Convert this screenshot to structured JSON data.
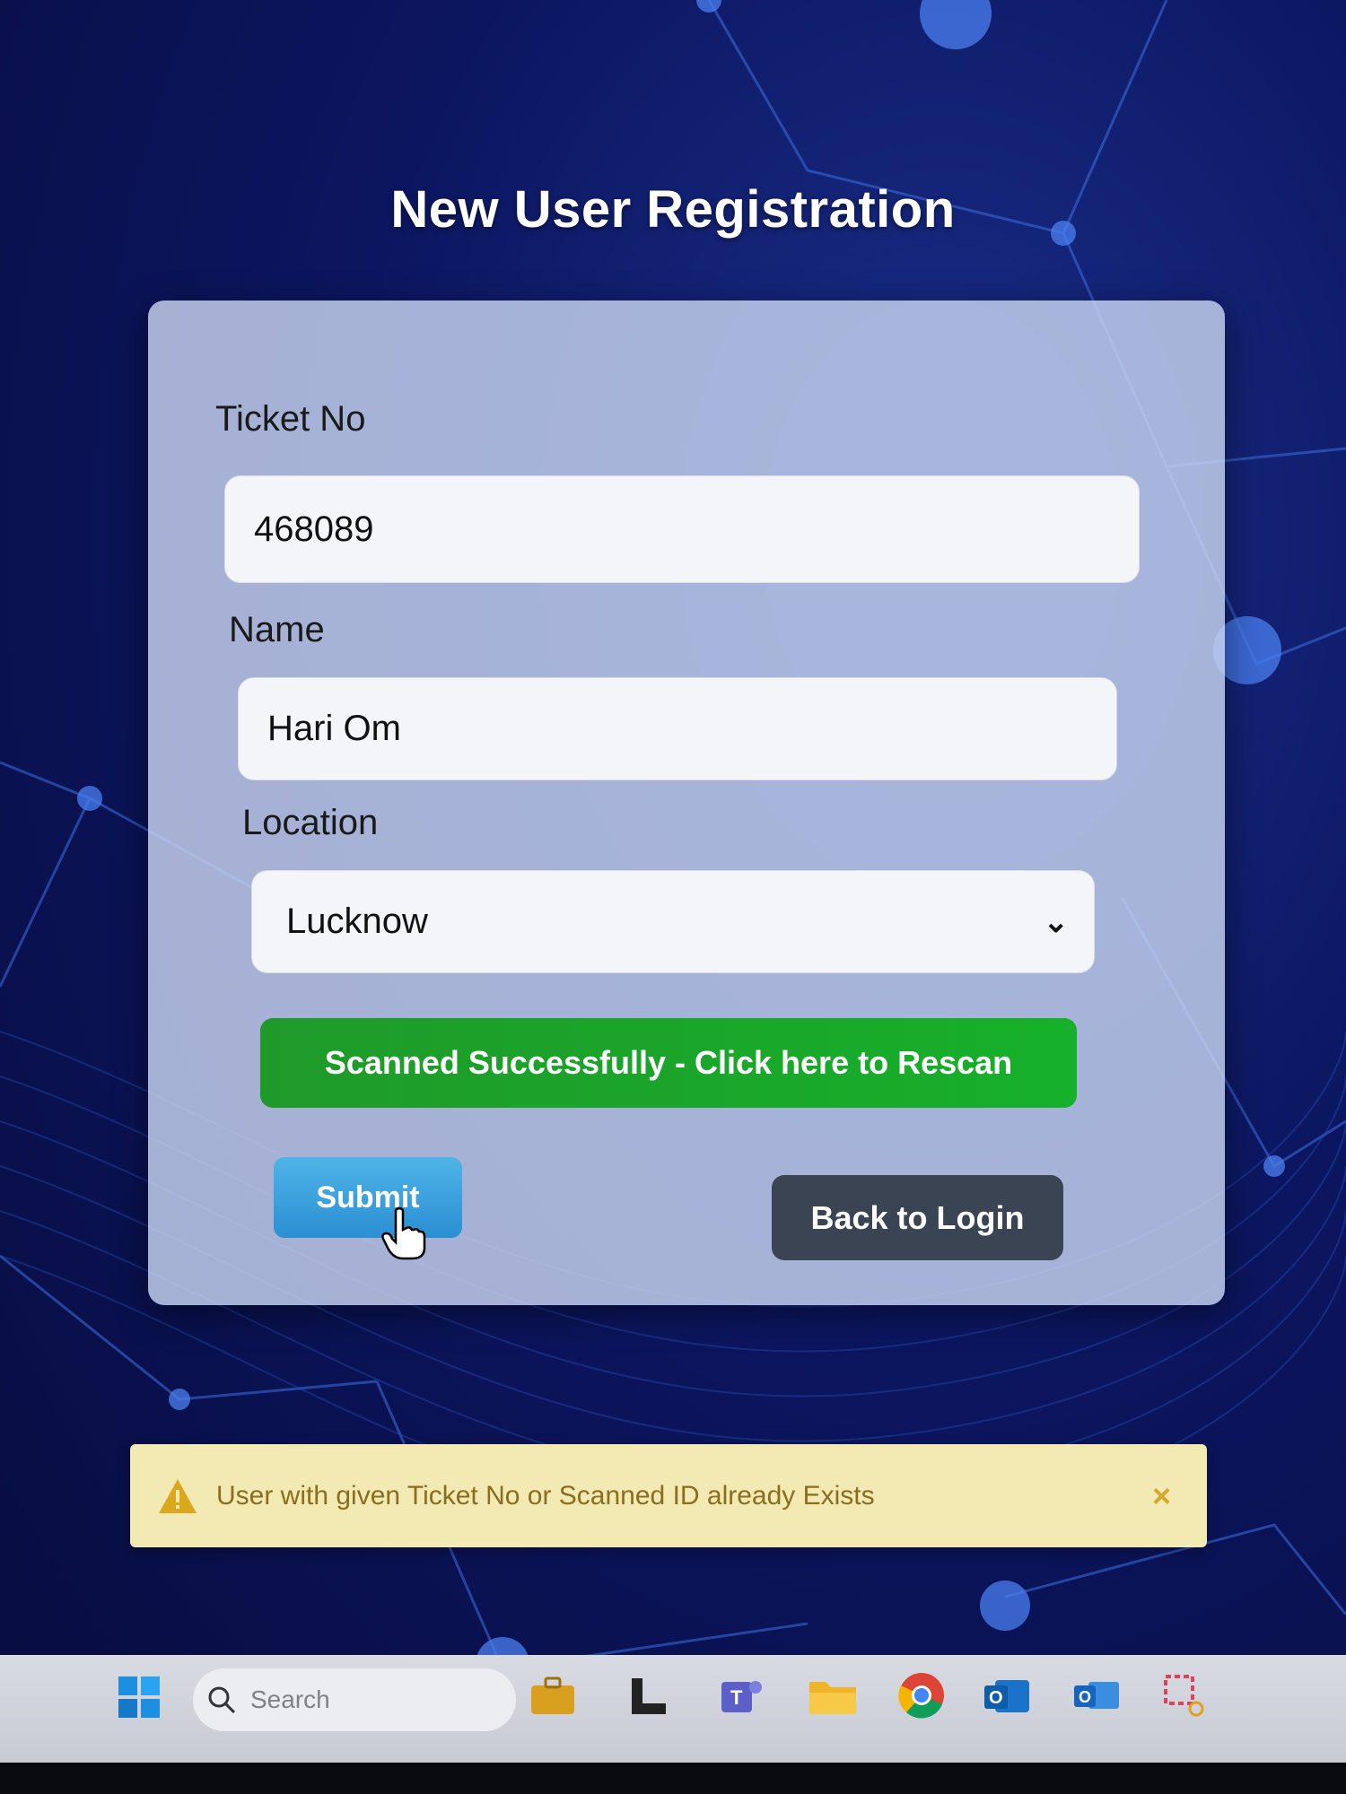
{
  "page_title": "New User Registration",
  "form": {
    "ticket_label": "Ticket No",
    "ticket_value": "468089",
    "name_label": "Name",
    "name_value": "Hari Om",
    "location_label": "Location",
    "location_value": "Lucknow",
    "scan_button_label": "Scanned Successfully - Click here to Rescan",
    "submit_label": "Submit",
    "back_label": "Back to Login"
  },
  "alert": {
    "message": "User with given Ticket No or Scanned ID already Exists",
    "close_symbol": "×",
    "icon": "warning-icon"
  },
  "taskbar": {
    "search_placeholder": "Search",
    "icons": [
      "windows-start-icon",
      "search-icon",
      "briefcase-icon",
      "app-icon",
      "teams-icon",
      "file-explorer-icon",
      "chrome-icon",
      "outlook-icon",
      "outlook-mail-icon",
      "snipping-tool-icon"
    ]
  },
  "colors": {
    "success_green": "#16b02a",
    "submit_blue": "#2b8fd2",
    "back_dark": "#3a4452",
    "alert_bg": "#f2e9b3"
  }
}
